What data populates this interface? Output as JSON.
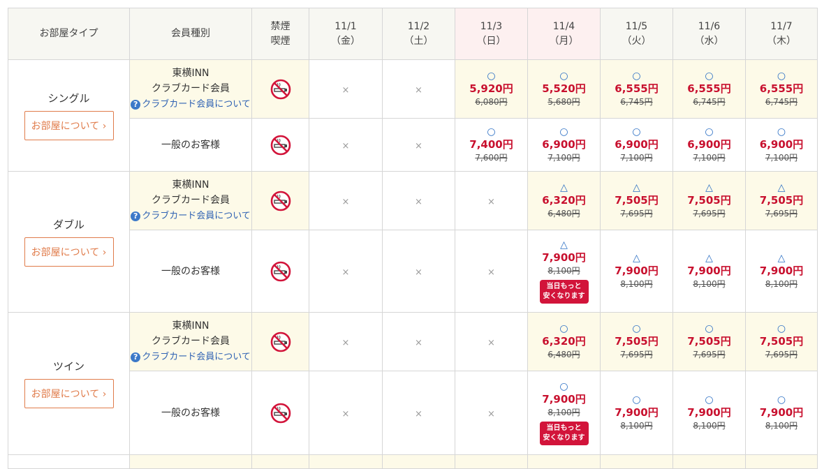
{
  "header": {
    "room_type": "お部屋タイプ",
    "member_type": "会員種別",
    "smoking_line1": "禁煙",
    "smoking_line2": "喫煙",
    "dates": [
      {
        "date": "11/1",
        "day": "（金）"
      },
      {
        "date": "11/2",
        "day": "（土）"
      },
      {
        "date": "11/3",
        "day": "（日）"
      },
      {
        "date": "11/4",
        "day": "（月）"
      },
      {
        "date": "11/5",
        "day": "（火）"
      },
      {
        "date": "11/6",
        "day": "（水）"
      },
      {
        "date": "11/7",
        "day": "（木）"
      }
    ]
  },
  "labels": {
    "club_line1": "東横INN",
    "club_line2": "クラブカード会員",
    "club_link": "クラブカード会員について",
    "general": "一般のお客様",
    "room_button": "お部屋について",
    "unavailable": "×",
    "badge_line1": "当日もっと",
    "badge_line2": "安くなります"
  },
  "colors": {
    "price": "#c8102e",
    "club_row_bg": "#fdfae8",
    "weekend_header_bg": "#fdf0f0",
    "button": "#e07b4a",
    "badge": "#d2143a",
    "link": "#2f62b3"
  },
  "rooms": [
    {
      "name": "シングル",
      "rows": [
        {
          "club": true,
          "cells": [
            null,
            null,
            {
              "mark": "○",
              "price": "5,920円",
              "old": "6,080円"
            },
            {
              "mark": "○",
              "price": "5,520円",
              "old": "5,680円"
            },
            {
              "mark": "○",
              "price": "6,555円",
              "old": "6,745円"
            },
            {
              "mark": "○",
              "price": "6,555円",
              "old": "6,745円"
            },
            {
              "mark": "○",
              "price": "6,555円",
              "old": "6,745円"
            }
          ]
        },
        {
          "club": false,
          "cells": [
            null,
            null,
            {
              "mark": "○",
              "price": "7,400円",
              "old": "7,600円"
            },
            {
              "mark": "○",
              "price": "6,900円",
              "old": "7,100円"
            },
            {
              "mark": "○",
              "price": "6,900円",
              "old": "7,100円"
            },
            {
              "mark": "○",
              "price": "6,900円",
              "old": "7,100円"
            },
            {
              "mark": "○",
              "price": "6,900円",
              "old": "7,100円"
            }
          ]
        }
      ]
    },
    {
      "name": "ダブル",
      "rows": [
        {
          "club": true,
          "cells": [
            null,
            null,
            null,
            {
              "mark": "△",
              "price": "6,320円",
              "old": "6,480円"
            },
            {
              "mark": "△",
              "price": "7,505円",
              "old": "7,695円"
            },
            {
              "mark": "△",
              "price": "7,505円",
              "old": "7,695円"
            },
            {
              "mark": "△",
              "price": "7,505円",
              "old": "7,695円"
            }
          ]
        },
        {
          "club": false,
          "cells": [
            null,
            null,
            null,
            {
              "mark": "△",
              "price": "7,900円",
              "old": "8,100円",
              "badge": true
            },
            {
              "mark": "△",
              "price": "7,900円",
              "old": "8,100円"
            },
            {
              "mark": "△",
              "price": "7,900円",
              "old": "8,100円"
            },
            {
              "mark": "△",
              "price": "7,900円",
              "old": "8,100円"
            }
          ]
        }
      ]
    },
    {
      "name": "ツイン",
      "rows": [
        {
          "club": true,
          "cells": [
            null,
            null,
            null,
            {
              "mark": "○",
              "price": "6,320円",
              "old": "6,480円"
            },
            {
              "mark": "○",
              "price": "7,505円",
              "old": "7,695円"
            },
            {
              "mark": "○",
              "price": "7,505円",
              "old": "7,695円"
            },
            {
              "mark": "○",
              "price": "7,505円",
              "old": "7,695円"
            }
          ]
        },
        {
          "club": false,
          "cells": [
            null,
            null,
            null,
            {
              "mark": "○",
              "price": "7,900円",
              "old": "8,100円",
              "badge": true
            },
            {
              "mark": "○",
              "price": "7,900円",
              "old": "8,100円"
            },
            {
              "mark": "○",
              "price": "7,900円",
              "old": "8,100円"
            },
            {
              "mark": "○",
              "price": "7,900円",
              "old": "8,100円"
            }
          ]
        }
      ]
    }
  ]
}
